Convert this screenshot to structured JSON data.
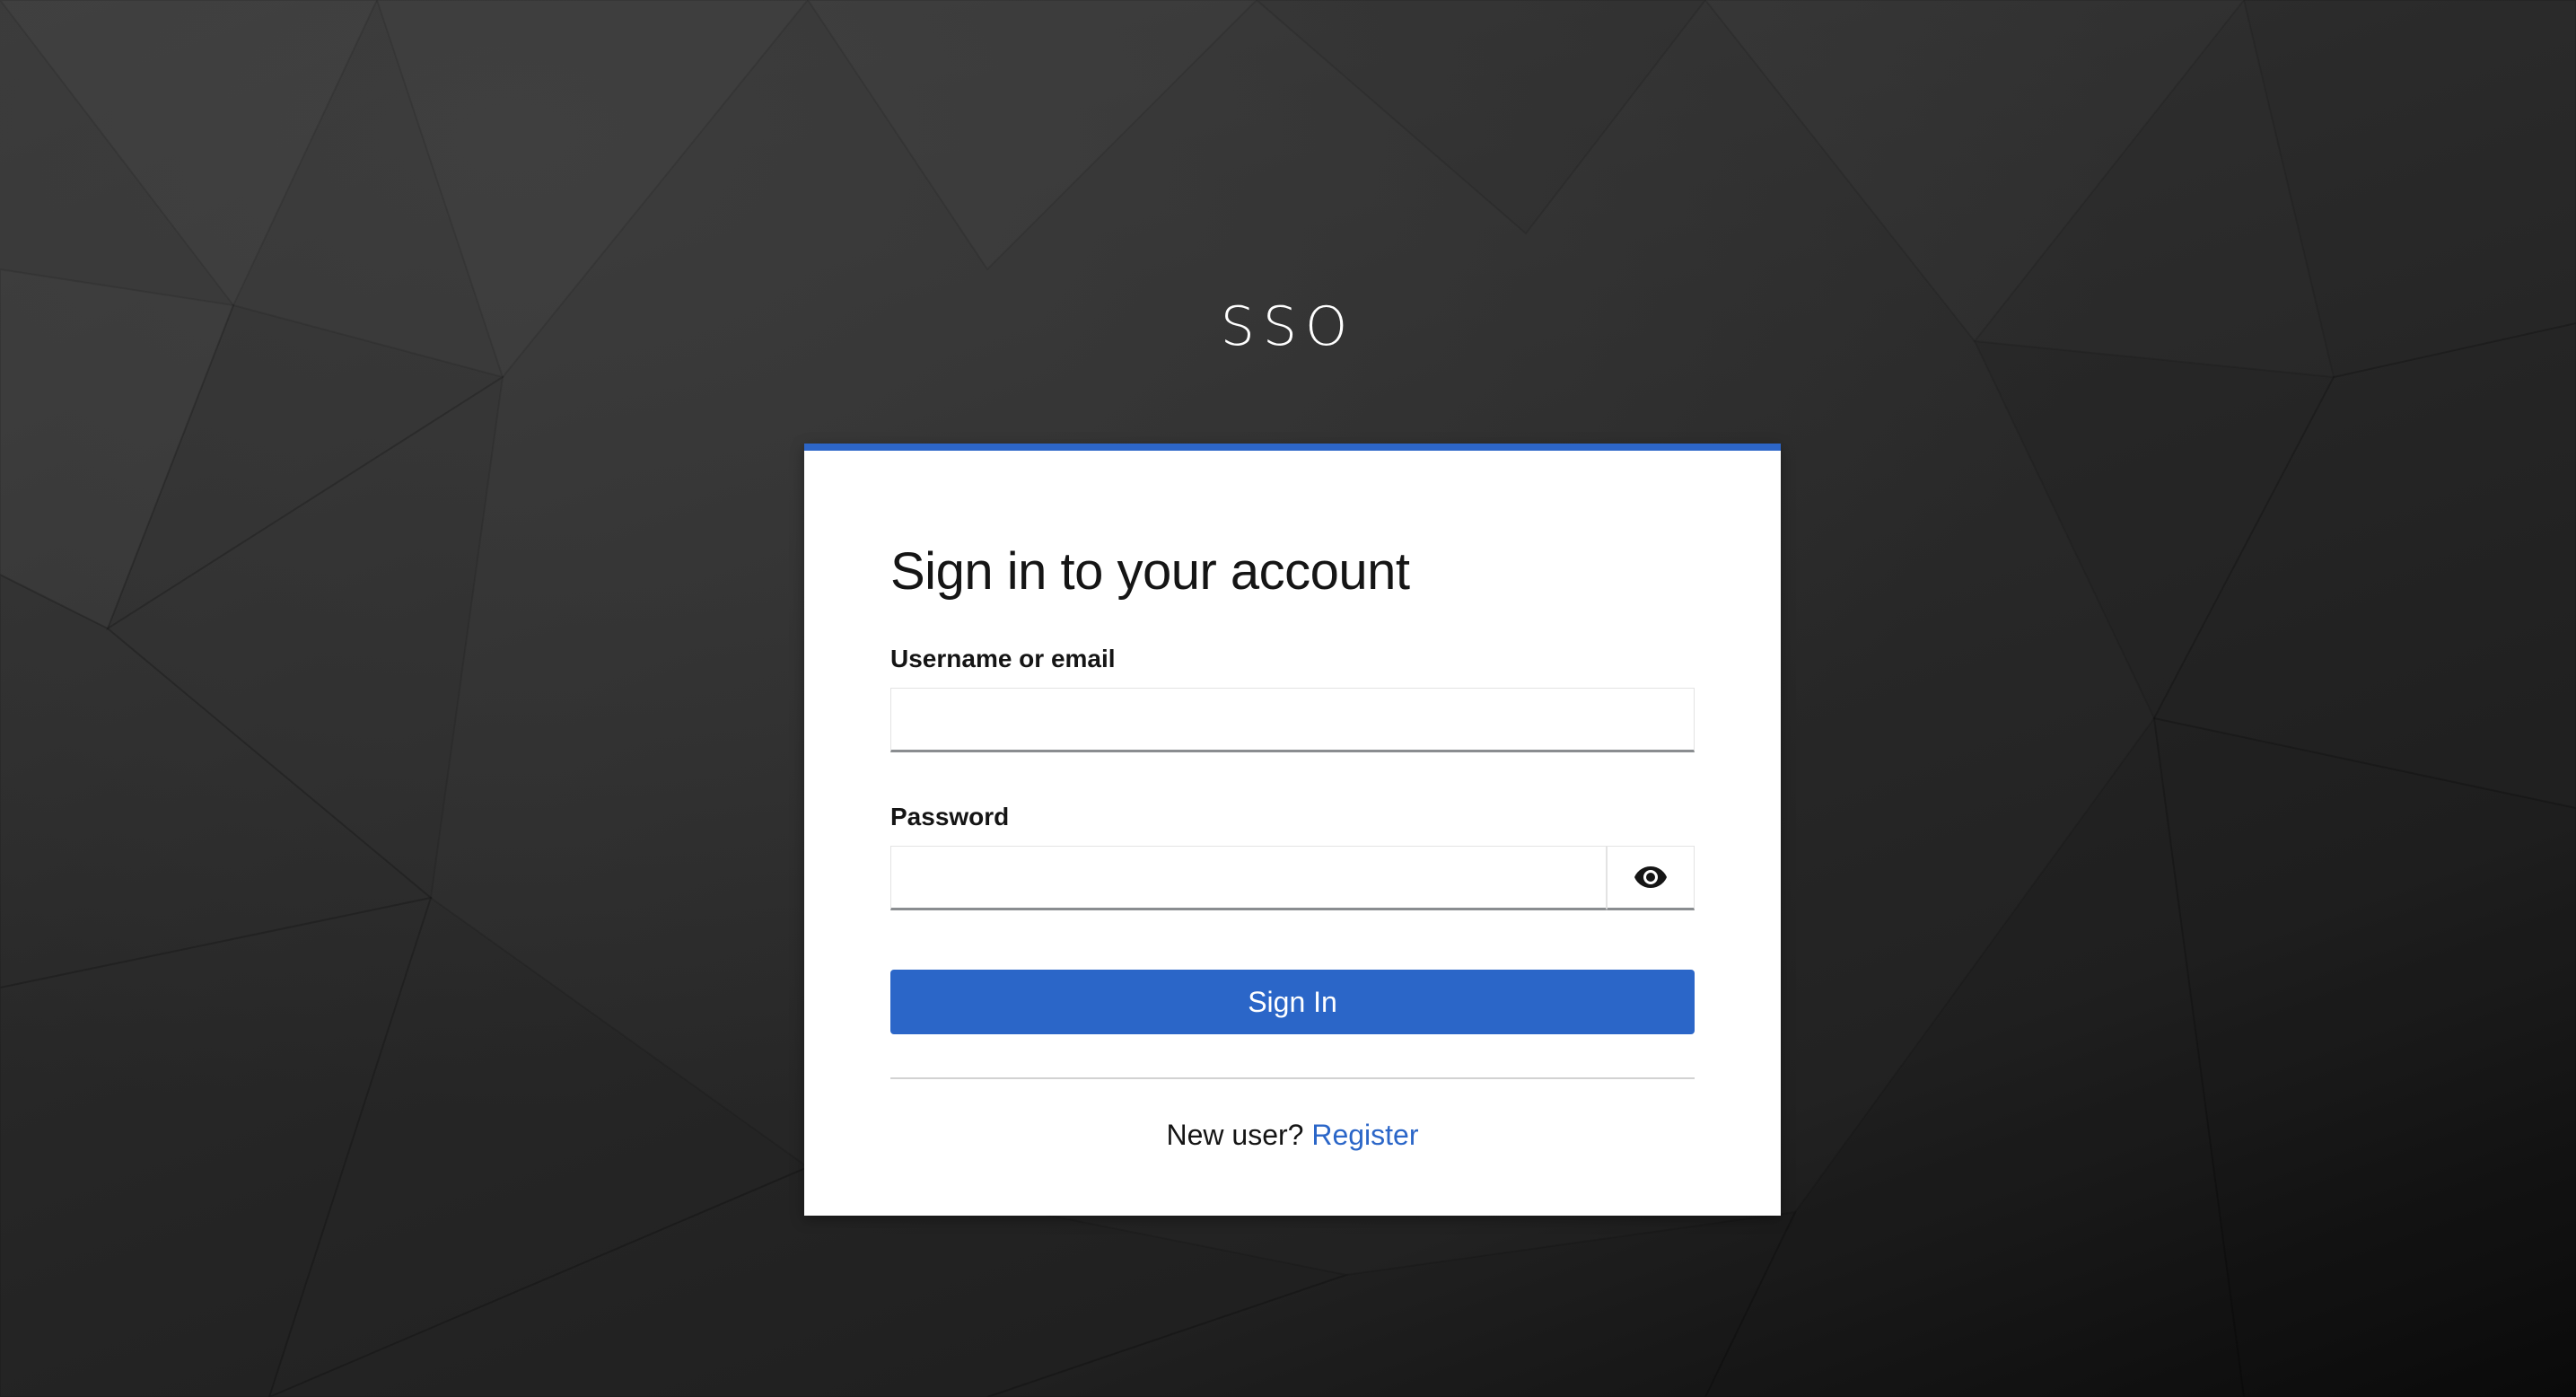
{
  "brand": {
    "name": "SSO"
  },
  "login": {
    "title": "Sign in to your account",
    "username_label": "Username or email",
    "username_value": "",
    "password_label": "Password",
    "password_value": "",
    "show_password_icon": "eye-icon",
    "submit_label": "Sign In",
    "register_prompt": "New user?",
    "register_link": "Register"
  },
  "colors": {
    "accent": "#2b66c8",
    "background": "#2a2a2a",
    "card": "#ffffff"
  }
}
